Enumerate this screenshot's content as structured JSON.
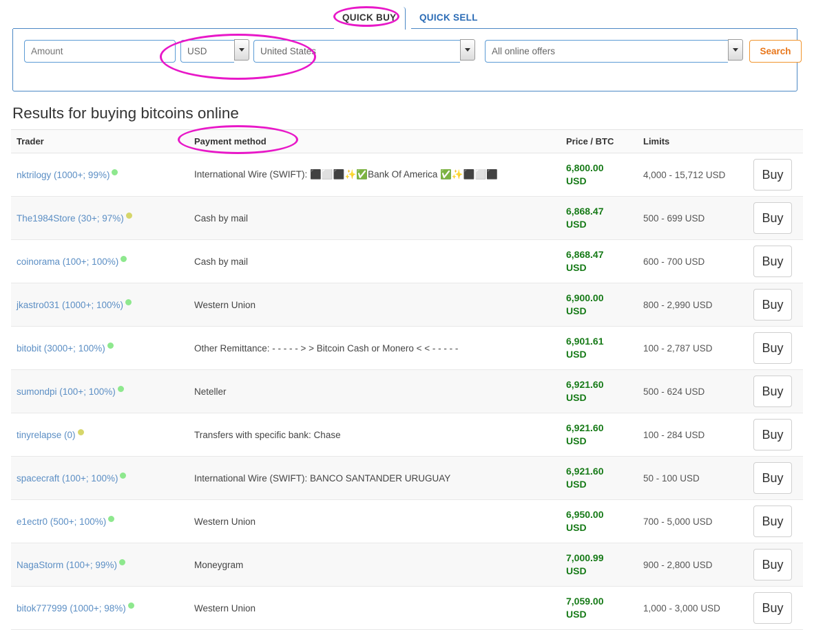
{
  "search": {
    "tabs": [
      {
        "label": "QUICK BUY",
        "active": true
      },
      {
        "label": "QUICK SELL",
        "active": false
      }
    ],
    "amount_placeholder": "Amount",
    "currency_value": "USD",
    "country_value": "United States",
    "offers_value": "All online offers",
    "search_button": "Search"
  },
  "results": {
    "title": "Results for buying bitcoins online",
    "columns": {
      "trader": "Trader",
      "payment": "Payment method",
      "price": "Price / BTC",
      "limits": "Limits",
      "action": ""
    },
    "buy_label": "Buy",
    "rows": [
      {
        "trader": "nktrilogy (1000+; 99%)",
        "status": "green",
        "payment": "International Wire (SWIFT): ⬛⬜⬛✨✅Bank Of America ✅✨⬛⬜⬛",
        "price": "6,800.00",
        "currency": "USD",
        "limits": "4,000 - 15,712 USD"
      },
      {
        "trader": "The1984Store (30+; 97%)",
        "status": "yellow",
        "payment": "Cash by mail",
        "price": "6,868.47",
        "currency": "USD",
        "limits": "500 - 699 USD"
      },
      {
        "trader": "coinorama (100+; 100%)",
        "status": "green",
        "payment": "Cash by mail",
        "price": "6,868.47",
        "currency": "USD",
        "limits": "600 - 700 USD"
      },
      {
        "trader": "jkastro031 (1000+; 100%)",
        "status": "green",
        "payment": "Western Union",
        "price": "6,900.00",
        "currency": "USD",
        "limits": "800 - 2,990 USD"
      },
      {
        "trader": "bitobit (3000+; 100%)",
        "status": "green",
        "payment": "Other Remittance: - - - - - > > Bitcoin Cash or Monero < < - - - - -",
        "price": "6,901.61",
        "currency": "USD",
        "limits": "100 - 2,787 USD"
      },
      {
        "trader": "sumondpi (100+; 100%)",
        "status": "green",
        "payment": "Neteller",
        "price": "6,921.60",
        "currency": "USD",
        "limits": "500 - 624 USD"
      },
      {
        "trader": "tinyrelapse (0)",
        "status": "yellow",
        "payment": "Transfers with specific bank: Chase",
        "price": "6,921.60",
        "currency": "USD",
        "limits": "100 - 284 USD"
      },
      {
        "trader": "spacecraft (100+; 100%)",
        "status": "green",
        "payment": "International Wire (SWIFT): BANCO SANTANDER URUGUAY",
        "price": "6,921.60",
        "currency": "USD",
        "limits": "50 - 100 USD"
      },
      {
        "trader": "e1ectr0 (500+; 100%)",
        "status": "green",
        "payment": "Western Union",
        "price": "6,950.00",
        "currency": "USD",
        "limits": "700 - 5,000 USD"
      },
      {
        "trader": "NagaStorm (100+; 99%)",
        "status": "green",
        "payment": "Moneygram",
        "price": "7,000.99",
        "currency": "USD",
        "limits": "900 - 2,800 USD"
      },
      {
        "trader": "bitok777999 (1000+; 98%)",
        "status": "green",
        "payment": "Western Union",
        "price": "7,059.00",
        "currency": "USD",
        "limits": "1,000 - 3,000 USD"
      }
    ]
  },
  "annotations": {
    "color": "#e818c8",
    "targets": [
      "quick-buy-tab",
      "currency-and-country-selectors",
      "payment-method-column"
    ]
  }
}
